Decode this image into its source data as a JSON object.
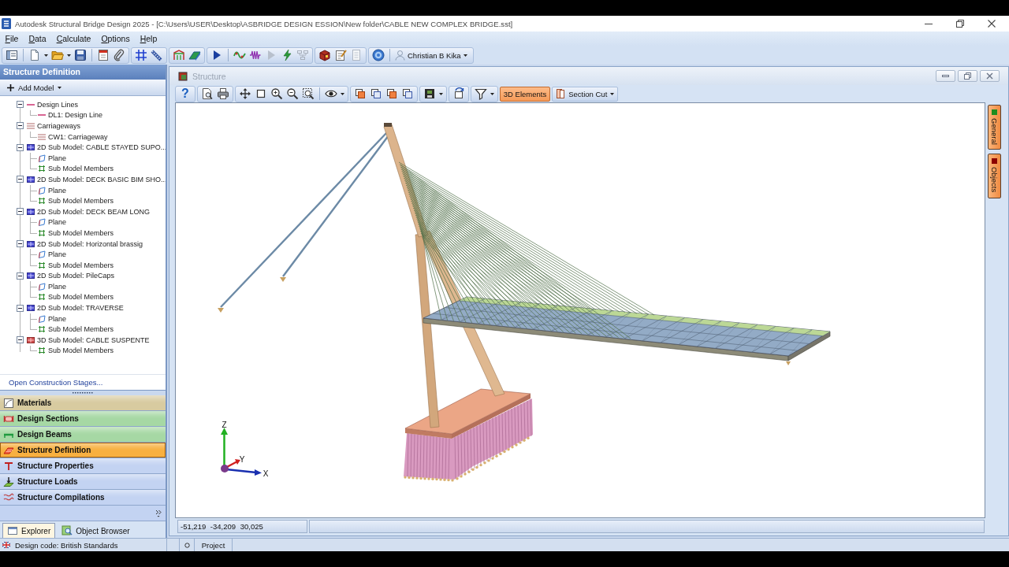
{
  "window": {
    "title": "Autodesk Structural Bridge Design 2025 - [C:\\Users\\USER\\Desktop\\ASBRIDGE DESIGN ESSION\\New folder\\CABLE NEW COMPLEX BRIDGE.sst]"
  },
  "menu": [
    "File",
    "Data",
    "Calculate",
    "Options",
    "Help"
  ],
  "toolbar": {
    "user": "Christian B Kika"
  },
  "sidebar": {
    "title": "Structure Definition",
    "add_button": "Add Model",
    "tree": [
      {
        "kind": "design-lines",
        "label": "Design Lines",
        "expanded": true,
        "children": [
          {
            "kind": "design-line",
            "label": "DL1: Design Line"
          }
        ]
      },
      {
        "kind": "carriageways",
        "label": "Carriageways",
        "expanded": true,
        "children": [
          {
            "kind": "carriageway",
            "label": "CW1: Carriageway"
          }
        ]
      },
      {
        "kind": "sub-model-2d",
        "label": "2D Sub Model: CABLE STAYED SUPO...",
        "expanded": true,
        "children": [
          {
            "kind": "plane",
            "label": "Plane"
          },
          {
            "kind": "members",
            "label": "Sub Model Members"
          }
        ]
      },
      {
        "kind": "sub-model-2d",
        "label": "2D Sub Model: DECK BASIC BIM SHO...",
        "expanded": true,
        "children": [
          {
            "kind": "plane",
            "label": "Plane"
          },
          {
            "kind": "members",
            "label": "Sub Model Members"
          }
        ]
      },
      {
        "kind": "sub-model-2d",
        "label": "2D Sub Model: DECK BEAM LONG",
        "expanded": true,
        "children": [
          {
            "kind": "plane",
            "label": "Plane"
          },
          {
            "kind": "members",
            "label": "Sub Model Members"
          }
        ]
      },
      {
        "kind": "sub-model-2d",
        "label": "2D Sub Model: Horizontal brassig",
        "expanded": true,
        "children": [
          {
            "kind": "plane",
            "label": "Plane"
          },
          {
            "kind": "members",
            "label": "Sub Model Members"
          }
        ]
      },
      {
        "kind": "sub-model-2d",
        "label": "2D Sub Model: PileCaps",
        "expanded": true,
        "children": [
          {
            "kind": "plane",
            "label": "Plane"
          },
          {
            "kind": "members",
            "label": "Sub Model Members"
          }
        ]
      },
      {
        "kind": "sub-model-2d",
        "label": "2D Sub Model: TRAVERSE",
        "expanded": true,
        "children": [
          {
            "kind": "plane",
            "label": "Plane"
          },
          {
            "kind": "members",
            "label": "Sub Model Members"
          }
        ]
      },
      {
        "kind": "sub-model-3d",
        "label": "3D Sub Model: CABLE SUSPENTE",
        "expanded": true,
        "children": [
          {
            "kind": "members",
            "label": "Sub Model Members"
          }
        ]
      }
    ],
    "link": "Open Construction Stages...",
    "nav": [
      {
        "kind": "materials",
        "label": "Materials",
        "color": "#d8cba0",
        "selected": false
      },
      {
        "kind": "sections",
        "label": "Design Sections",
        "color": "#a6d8a4",
        "selected": false
      },
      {
        "kind": "beams",
        "label": "Design Beams",
        "color": "#a6d8a4",
        "selected": false
      },
      {
        "kind": "definition",
        "label": "Structure Definition",
        "color": "#f8b040",
        "selected": true
      },
      {
        "kind": "properties",
        "label": "Structure Properties",
        "color": "#c3d3f2",
        "selected": false
      },
      {
        "kind": "loads",
        "label": "Structure Loads",
        "color": "#c3d3f2",
        "selected": false
      },
      {
        "kind": "compilations",
        "label": "Structure Compilations",
        "color": "#c3d3f2",
        "selected": false
      }
    ],
    "tabs": [
      {
        "kind": "explorer",
        "label": "Explorer",
        "selected": true
      },
      {
        "kind": "object-browser",
        "label": "Object Browser",
        "selected": false
      }
    ]
  },
  "structure_window": {
    "title": "Structure",
    "help": "?",
    "buttons": [
      {
        "kind": "toggle",
        "label": "3D Elements",
        "selected": true
      },
      {
        "kind": "dropdown",
        "label": "Section Cut",
        "selected": false
      }
    ],
    "side_tabs": [
      {
        "label": "General",
        "color": "#1e8c1e"
      },
      {
        "label": "Objects",
        "color": "#8c0000"
      }
    ],
    "axes": [
      {
        "kind": "z",
        "label": "Z"
      },
      {
        "kind": "y",
        "label": "Y"
      },
      {
        "kind": "x",
        "label": "X"
      }
    ],
    "coordinates": "-51,219 -34,209 30,025"
  },
  "status_bar": {
    "design_code": "Design code: British Standards",
    "panel": "Project"
  }
}
